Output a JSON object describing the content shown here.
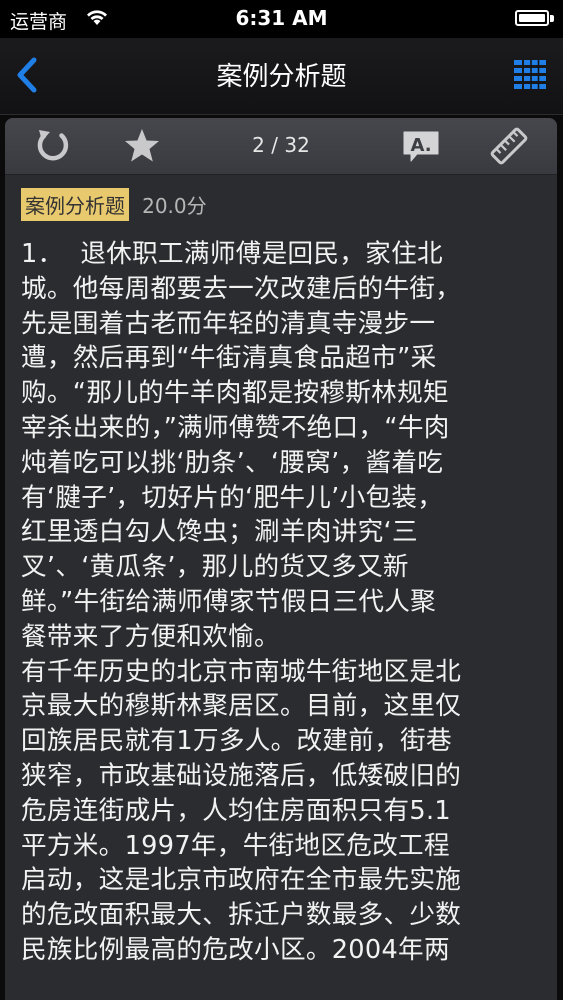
{
  "status_bar": {
    "carrier": "运营商",
    "time": "6:31 AM"
  },
  "nav": {
    "title": "案例分析题",
    "back_icon": "chevron-left-icon",
    "menu_icon": "grid-list-icon",
    "accent_color": "#1f7fe6"
  },
  "toolbar": {
    "counter": "2 / 32",
    "icons": [
      "refresh-icon",
      "star-icon",
      "answer-bubble-icon",
      "ruler-icon"
    ]
  },
  "question": {
    "type_label": "案例分析题",
    "type_highlight_color": "#e8c96d",
    "score": "20.0分",
    "paragraph_1": "1．  退休职工满师傅是回民，家住北\n城。他每周都要去一次改建后的牛街，\n先是围着古老而年轻的清真寺漫步一\n遭，然后再到“牛街清真食品超市”采\n购。“那儿的牛羊肉都是按穆斯林规矩\n宰杀出来的，”满师傅赞不绝口，“牛肉\n炖着吃可以挑‘肋条’、‘腰窝’，酱着吃\n有‘腱子’，切好片的‘肥牛儿’小包装，\n红里透白勾人馋虫；涮羊肉讲究‘三\n叉’、‘黄瓜条’，那儿的货又多又新\n鲜。”牛街给满师傅家节假日三代人聚\n餐带来了方便和欢愉。",
    "paragraph_2": "有千年历史的北京市南城牛街地区是北\n京最大的穆斯林聚居区。目前，这里仅\n回族居民就有1万多人。改建前，街巷\n狭窄，市政基础设施落后，低矮破旧的\n危房连街成片，人均住房面积只有5.1\n平方米。1997年，牛街地区危改工程\n启动，这是北京市政府在全市最先实施\n的危改面积最大、拆迁户数最多、少数\n民族比例最高的危改小区。2004年两"
  }
}
